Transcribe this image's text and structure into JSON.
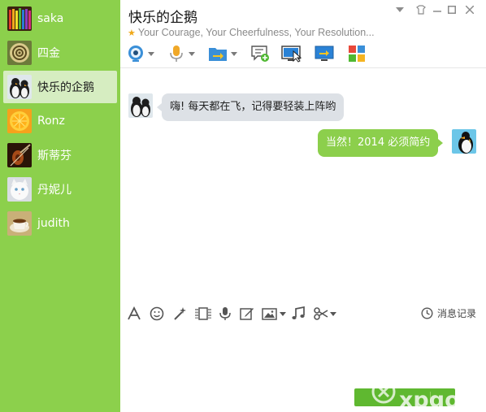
{
  "sidebar": {
    "contacts": [
      {
        "name": "saka",
        "avatar": "colored-pencils",
        "active": false
      },
      {
        "name": "四金",
        "avatar": "spiral-shell",
        "active": false
      },
      {
        "name": "快乐的企鹅",
        "avatar": "penguins",
        "active": true
      },
      {
        "name": "Ronz",
        "avatar": "orange-slice",
        "active": false
      },
      {
        "name": "斯蒂芬",
        "avatar": "violin",
        "active": false
      },
      {
        "name": "丹妮儿",
        "avatar": "white-cat",
        "active": false
      },
      {
        "name": "judith",
        "avatar": "coffee-cup",
        "active": false
      }
    ]
  },
  "header": {
    "title": "快乐的企鹅",
    "signature": "Your Courage, Your Cheerfulness, Your Resolution...",
    "window_controls": [
      "dropdown",
      "skin",
      "minimize",
      "maximize",
      "close"
    ],
    "toolbar": [
      "video-call",
      "voice-call",
      "file-transfer",
      "create-group",
      "remote-assistance",
      "share-screen",
      "apps"
    ]
  },
  "messages": [
    {
      "direction": "received",
      "text": "嗨! 每天都在飞，记得要轻装上阵哟"
    },
    {
      "direction": "sent",
      "text": "当然！2014 必须简约"
    }
  ],
  "input_toolbar": {
    "tools": [
      "font",
      "emoji",
      "nudge",
      "screen-capture-frame",
      "voice-message",
      "handwriting",
      "image",
      "music",
      "scissors"
    ],
    "history_label": "消息记录"
  },
  "watermark": "xpgod",
  "colors": {
    "sidebar_bg": "#8cd04c",
    "active_contact_bg": "#d6edc1",
    "sent_bubble": "#8ccf4c",
    "received_bubble": "#dde1e6",
    "send_button": "#5fb830"
  }
}
